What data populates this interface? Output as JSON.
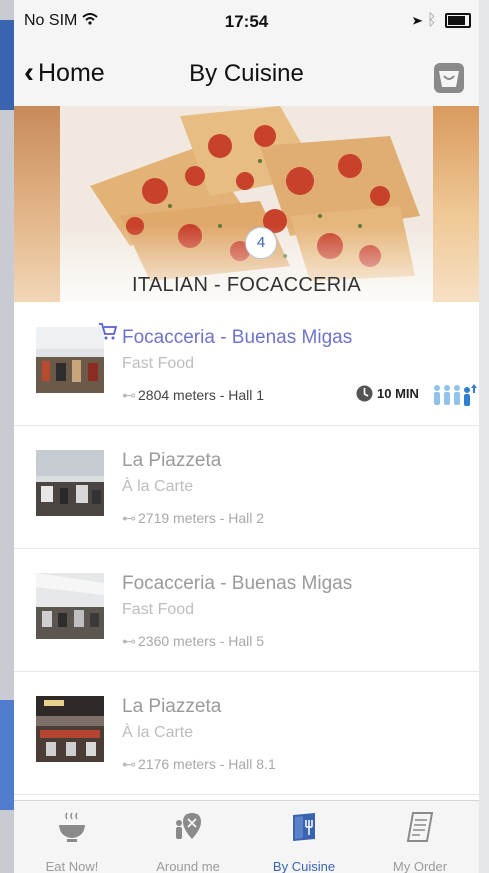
{
  "status_bar": {
    "carrier": "No SIM",
    "time": "17:54"
  },
  "nav": {
    "back_label": "Home",
    "title": "By Cuisine",
    "basket_icon": "basket-icon"
  },
  "hero": {
    "count": "4",
    "caption": "ITALIAN - FOCACCERIA"
  },
  "restaurants": [
    {
      "name": "Focacceria - Buenas Migas",
      "type": "Fast Food",
      "distance": "2804 meters - Hall 1",
      "wait": "10 MIN",
      "active": true
    },
    {
      "name": "La Piazzeta",
      "type": "À la Carte",
      "distance": "2719 meters - Hall 2"
    },
    {
      "name": "Focacceria - Buenas Migas",
      "type": "Fast Food",
      "distance": "2360 meters - Hall 5"
    },
    {
      "name": "La Piazzeta",
      "type": "À la Carte",
      "distance": "2176 meters - Hall 8.1"
    }
  ],
  "tabs": [
    {
      "label": "Eat Now!",
      "icon": "bowl-icon"
    },
    {
      "label": "Around me",
      "icon": "map-pin-icon"
    },
    {
      "label": "By Cuisine",
      "icon": "menu-book-icon",
      "active": true
    },
    {
      "label": "My Order",
      "icon": "receipt-icon"
    }
  ],
  "colors": {
    "accent": "#3a64b0",
    "active_name": "#6f73c9",
    "waiting_people": "#8fc3ec"
  }
}
